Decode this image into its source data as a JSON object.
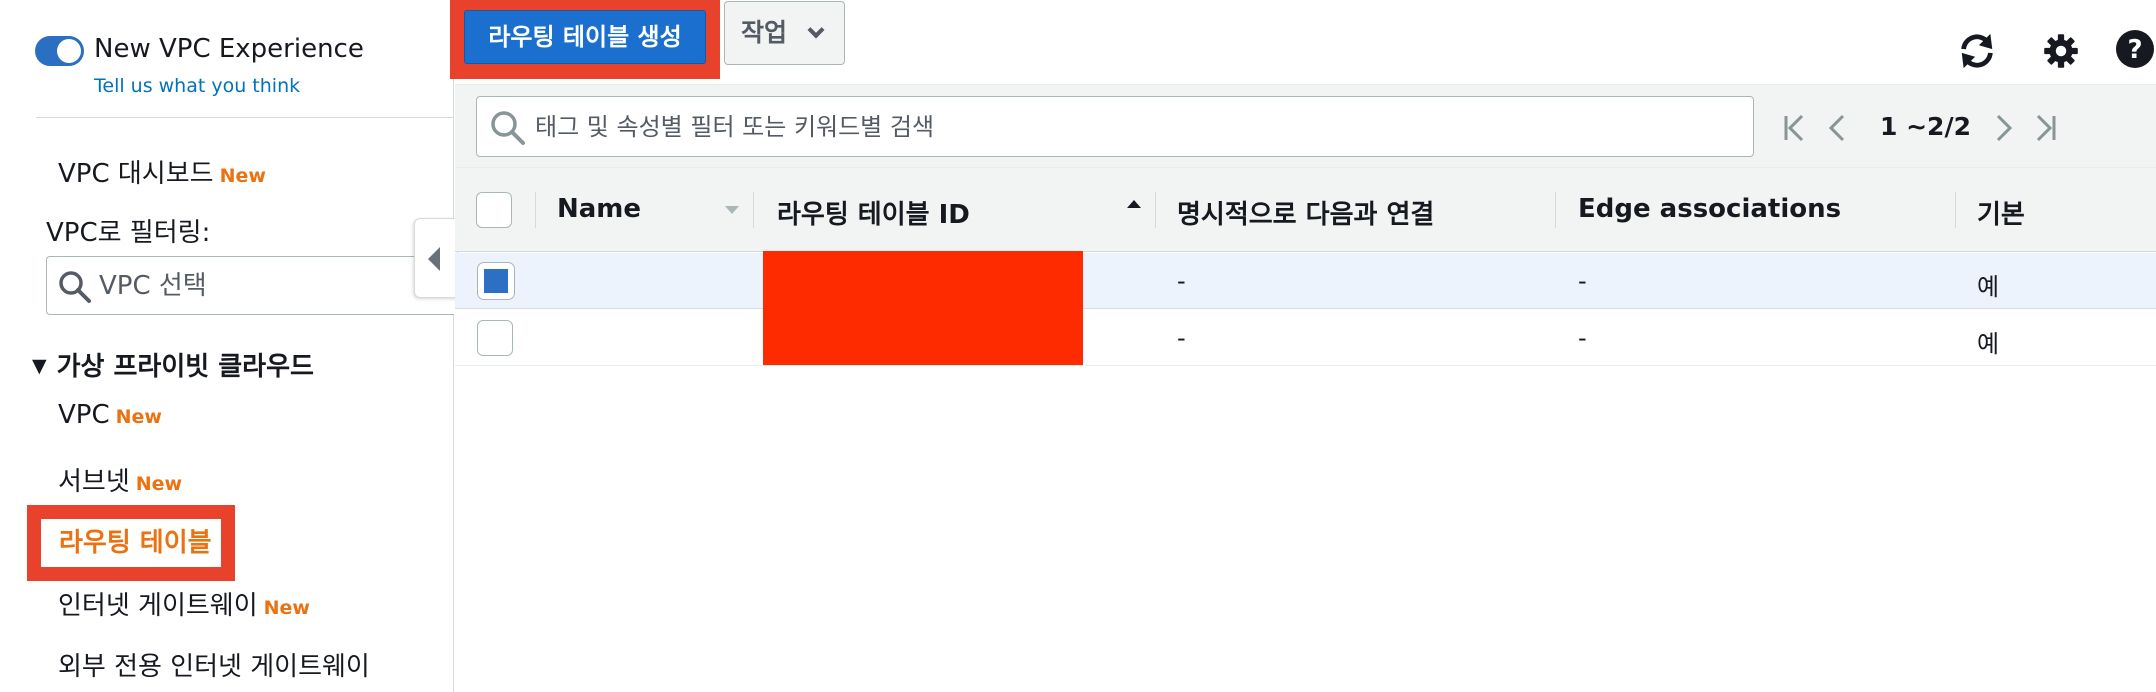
{
  "colors": {
    "accent": "#1a6fcf",
    "highlight_red": "#e8412c",
    "new_badge": "#ec7211",
    "redaction": "#fe2b00"
  },
  "sidebar": {
    "toggle_on": true,
    "experience_title": "New VPC Experience",
    "feedback_link": "Tell us what you think",
    "dashboard": {
      "label": "VPC 대시보드",
      "badge": "New"
    },
    "filter_label": "VPC로 필터링:",
    "vpc_select_placeholder": "VPC 선택",
    "section_title": "가상 프라이빗 클라우드",
    "items": [
      {
        "label": "VPC",
        "badge": "New"
      },
      {
        "label": "서브넷",
        "badge": "New"
      },
      {
        "label": "라우팅 테이블",
        "badge": "",
        "active": true
      },
      {
        "label": "인터넷 게이트웨이",
        "badge": "New"
      },
      {
        "label": "외부 전용 인터넷 게이트웨이",
        "badge": ""
      }
    ]
  },
  "toolbar": {
    "create_label": "라우팅 테이블 생성",
    "actions_label": "작업",
    "icons": [
      "refresh-icon",
      "gear-icon",
      "help-icon"
    ]
  },
  "filter": {
    "search_placeholder": "태그 및 속성별 필터 또는 키워드별 검색",
    "pagination": "1 ~2/2"
  },
  "table": {
    "columns": [
      "Name",
      "라우팅 테이블 ID",
      "명시적으로 다음과 연결",
      "Edge associations",
      "기본"
    ],
    "rows": [
      {
        "selected": true,
        "name": "",
        "id": "",
        "explicit": "-",
        "edge": "-",
        "main": "예"
      },
      {
        "selected": false,
        "name": "",
        "id": "",
        "explicit": "-",
        "edge": "-",
        "main": "예"
      }
    ]
  }
}
